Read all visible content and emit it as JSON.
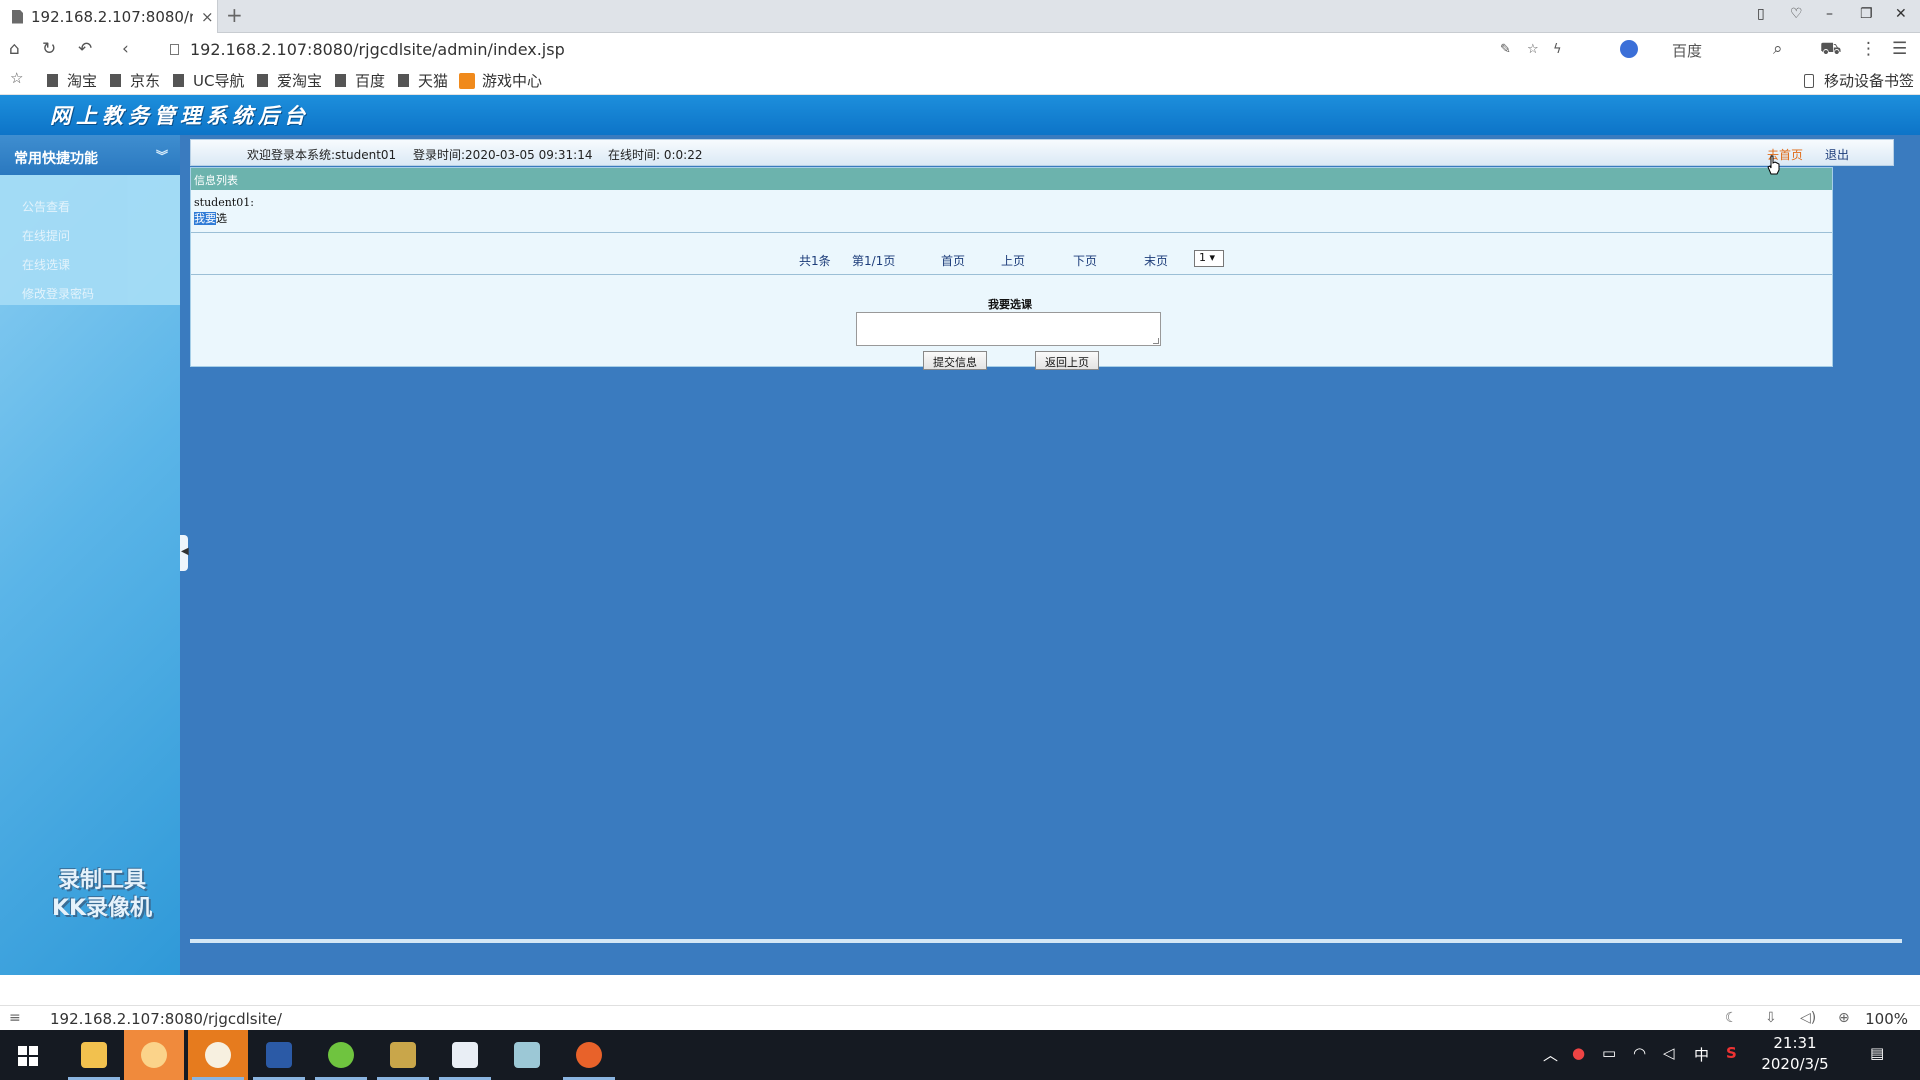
{
  "browser": {
    "tab_title": "192.168.2.107:8080/r",
    "tab_close": "×",
    "new_tab": "+",
    "url": "192.168.2.107:8080/rjgcdlsite/admin/index.jsp",
    "search_engine": "百度",
    "bookmarks": [
      "淘宝",
      "京东",
      "UC导航",
      "爱淘宝",
      "百度",
      "天猫",
      "游戏中心"
    ],
    "mobile_bookmarks": "移动设备书签",
    "status_url": "192.168.2.107:8080/rjgcdlsite/",
    "zoom": "100%"
  },
  "page": {
    "system_title": "网上教务管理系统后台",
    "sidebar": {
      "header": "常用快捷功能",
      "items": [
        "公告查看",
        "在线提问",
        "在线选课",
        "修改登录密码"
      ],
      "watermark_line1": "录制工具",
      "watermark_line2": "KK录像机"
    },
    "topbar": {
      "welcome": "欢迎登录本系统:student01",
      "login_time": "登录时间:2020-03-05 09:31:14",
      "online_time": "在线时间: 0:0:22",
      "home_link": "去首页",
      "logout_link": "退出"
    },
    "content": {
      "header": "信息列表",
      "message_user": "student01:",
      "message_highlight": "我要",
      "message_rest": "选",
      "pagination": {
        "total": "共1条",
        "page_info": "第1/1页",
        "first": "首页",
        "prev": "上页",
        "next": "下页",
        "last": "末页",
        "select_value": "1 ▾"
      },
      "form": {
        "label": "我要选课",
        "textarea_value": "",
        "submit": "提交信息",
        "back": "返回上页"
      }
    }
  },
  "taskbar": {
    "clock_time": "21:31",
    "clock_date": "2020/3/5",
    "ime": "中"
  },
  "colors": {
    "banner": "#0d74c8",
    "page_bg": "#3a7bbf",
    "content_header": "#6cb3ad",
    "home_link": "#e06b18"
  }
}
